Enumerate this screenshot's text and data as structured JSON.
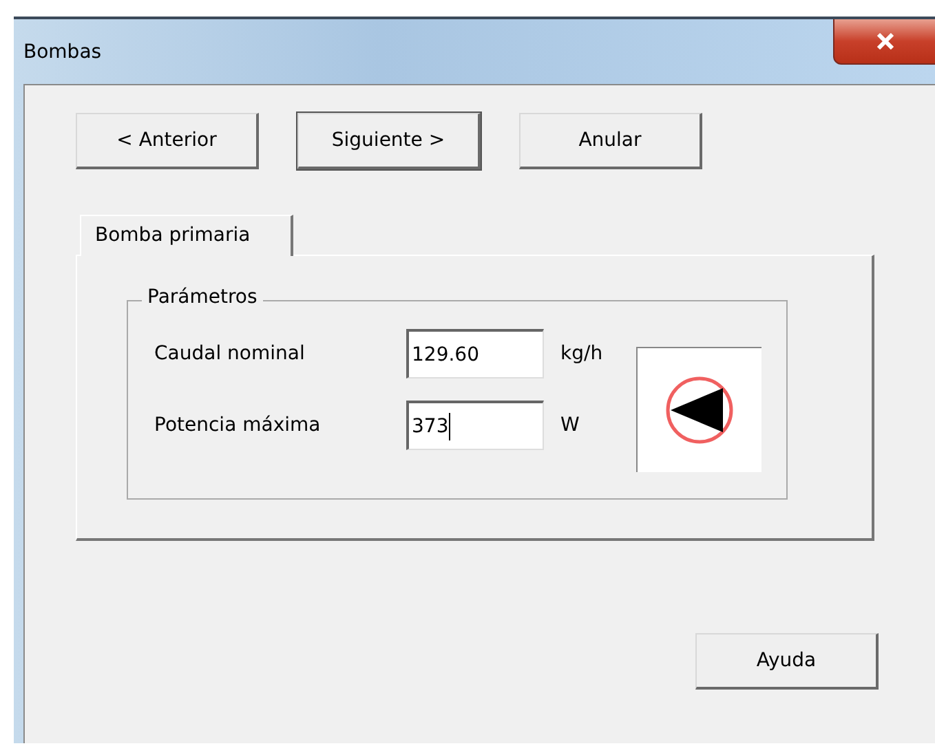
{
  "window": {
    "title": "Bombas"
  },
  "nav_buttons": [
    {
      "label": "< Anterior",
      "default": false
    },
    {
      "label": "Siguiente >",
      "default": true
    },
    {
      "label": "Anular",
      "default": false
    }
  ],
  "tabs": [
    {
      "label": "Bomba primaria",
      "selected": true
    }
  ],
  "group": {
    "title": "Parámetros",
    "fields": [
      {
        "label": "Caudal nominal",
        "value": "129.60",
        "unit": "kg/h",
        "focused": false
      },
      {
        "label": "Potencia máxima",
        "value": "373",
        "unit": "W",
        "focused": true
      }
    ]
  },
  "help_button": {
    "label": "Ayuda"
  }
}
